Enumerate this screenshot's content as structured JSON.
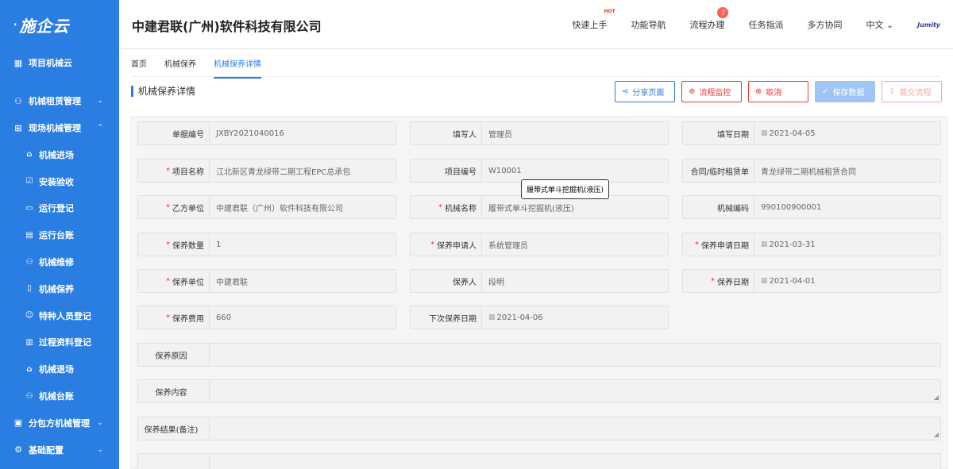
{
  "sidebar": {
    "logo": "施企云",
    "items": [
      {
        "label": "项目机械云",
        "icon": "grid-icon"
      },
      {
        "label": "机械租赁管理",
        "icon": "org-icon",
        "chevron": "⌄"
      },
      {
        "label": "现场机械管理",
        "icon": "layout-icon",
        "chevron": "⌃"
      },
      {
        "label": "分包方机械管理",
        "icon": "build-icon",
        "chevron": "⌄"
      },
      {
        "label": "基础配置",
        "icon": "settings-icon",
        "chevron": "⌄"
      }
    ],
    "subitems": [
      {
        "label": "机械进场",
        "icon": "home-icon"
      },
      {
        "label": "安装验收",
        "icon": "check-icon"
      },
      {
        "label": "运行登记",
        "icon": "chart-icon"
      },
      {
        "label": "运行台账",
        "icon": "ledger-icon"
      },
      {
        "label": "机械维修",
        "icon": "repair-icon"
      },
      {
        "label": "机械保养",
        "icon": "doc-icon"
      },
      {
        "label": "特种人员登记",
        "icon": "person-icon"
      },
      {
        "label": "过程资料登记",
        "icon": "film-icon"
      },
      {
        "label": "机械退场",
        "icon": "exit-icon"
      },
      {
        "label": "机械台账",
        "icon": "list-icon"
      }
    ]
  },
  "header": {
    "company": "中建君联(广州)软件科技有限公司",
    "nav": [
      "快速上手",
      "功能导航",
      "流程办理",
      "任务指派",
      "多方协同",
      "中文"
    ],
    "hot": "HOT",
    "badge": "7",
    "brand": "Jumity"
  },
  "breadcrumb": [
    "首页",
    "机械保养",
    "机械保养详情"
  ],
  "page_title": "机械保养详情",
  "toolbar": {
    "share": "分享页面",
    "monitor": "流程监控",
    "cancel": "取消",
    "save": "保存数据",
    "submit": "提交流程"
  },
  "form": {
    "doc_no": {
      "label": "单据编号",
      "value": "JXBY2021040016"
    },
    "filler": {
      "label": "填写人",
      "value": "管理员"
    },
    "fill_date": {
      "label": "填写日期",
      "value": "2021-04-05"
    },
    "project_name": {
      "label": "项目名称",
      "value": "江北新区青龙绿带二期工程EPC总承包"
    },
    "project_no": {
      "label": "项目编号",
      "value": "W10001"
    },
    "contract": {
      "label": "合同/临时租赁单",
      "value": "青龙绿带二期机械租赁合同"
    },
    "party_b": {
      "label": "乙方单位",
      "value": "中建君联（广州）软件科技有限公司"
    },
    "machine_name": {
      "label": "机械名称",
      "value": "履带式单斗挖掘机(液压)"
    },
    "machine_code": {
      "label": "机械编码",
      "value": "990100900001"
    },
    "qty": {
      "label": "保养数量",
      "value": "1"
    },
    "applicant": {
      "label": "保养申请人",
      "value": "系统管理员"
    },
    "apply_date": {
      "label": "保养申请日期",
      "value": "2021-03-31"
    },
    "unit": {
      "label": "保养单位",
      "value": "中建君联"
    },
    "maintainer": {
      "label": "保养人",
      "value": "段明"
    },
    "maint_date": {
      "label": "保养日期",
      "value": "2021-04-01"
    },
    "cost": {
      "label": "保养费用",
      "value": "660"
    },
    "next_date": {
      "label": "下次保养日期",
      "value": "2021-04-06"
    },
    "reason": {
      "label": "保养原因",
      "value": ""
    },
    "content": {
      "label": "保养内容",
      "value": ""
    },
    "result": {
      "label": "保养结果(备注)",
      "value": ""
    }
  },
  "tooltip": "履带式单斗挖掘机(液压)"
}
